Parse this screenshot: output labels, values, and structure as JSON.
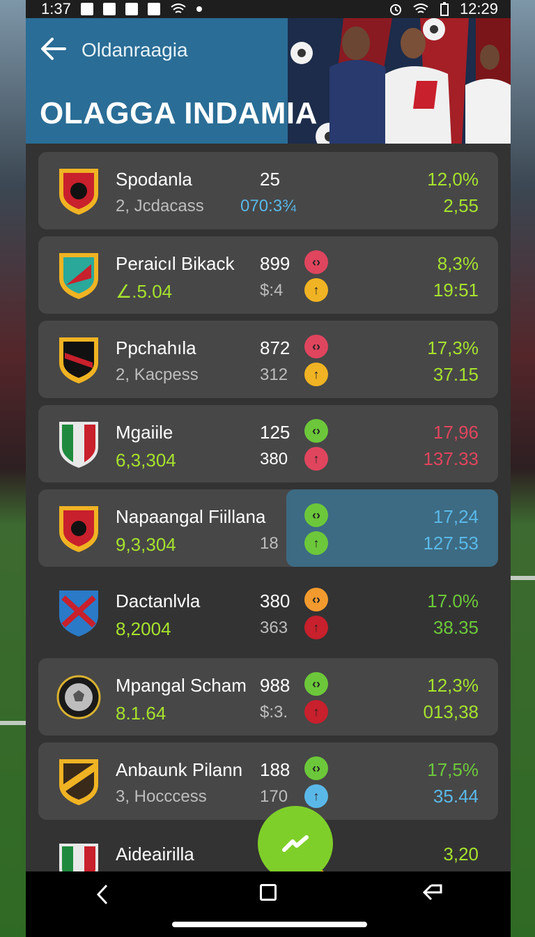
{
  "status_bar": {
    "time_left": "1:37",
    "time_right": "12:29"
  },
  "header": {
    "subtitle": "Oldanraagia",
    "title": "OLAGGA INDAMIA"
  },
  "colors": {
    "green": "#a6e22e",
    "blue": "#5ab8e8",
    "red": "#e0455e",
    "yellow": "#f0b323",
    "orange": "#f29a2e"
  },
  "rows": [
    {
      "team": "Spodanla",
      "sub": "2, Jcdacass",
      "n1": "25",
      "n2": "070:3¾",
      "r1": "12,0%",
      "r2": "2,55",
      "ic_top": "",
      "ic_bot": "",
      "r_color": "green"
    },
    {
      "team": "Peraicıl Bikack",
      "sub": "∠.5.04",
      "n1": "899",
      "n2": "$:4",
      "r1": "8,3%",
      "r2": "19:51",
      "ic_top": "red",
      "ic_bot": "yellow",
      "r_color": "green"
    },
    {
      "team": "Ppchahıla",
      "sub": "2, Kacpess",
      "n1": "872",
      "n2": "312",
      "r1": "17,3%",
      "r2": "37.15",
      "ic_top": "red",
      "ic_bot": "yellow",
      "r_color": "green"
    },
    {
      "team": "Mgaiile",
      "sub": "6,3,304",
      "n1": "125",
      "n2": "380",
      "r1": "17,96",
      "r2": "137.33",
      "ic_top": "green",
      "ic_bot": "red",
      "r_color": "red"
    },
    {
      "team": "Napaangal Fiillana",
      "sub": "9,3,304",
      "n1": "",
      "n2": "18",
      "r1": "17,24",
      "r2": "127.53",
      "ic_top": "green",
      "ic_bot": "green",
      "r_color": "blue"
    },
    {
      "team": "Dactanlvla",
      "sub": "8,2004",
      "n1": "380",
      "n2": "363",
      "r1": "17.0%",
      "r2": "38.35",
      "ic_top": "orange",
      "ic_bot": "red",
      "r_color": "green"
    },
    {
      "team": "Mpangal Scham",
      "sub": "8.1.64",
      "n1": "988",
      "n2": "$:3.",
      "r1": "12,3%",
      "r2": "013,38",
      "ic_top": "green",
      "ic_bot": "red",
      "r_color": "green"
    },
    {
      "team": "Anbaunk Pilann",
      "sub": "3, Hocccess",
      "n1": "188",
      "n2": "170",
      "r1": "17,5%",
      "r2": "35.44",
      "ic_top": "green",
      "ic_bot": "blue",
      "r_color": "green"
    },
    {
      "team": "Aideairilla",
      "sub": "",
      "n1": "",
      "n2": "",
      "r1": "3,20",
      "r2": "",
      "ic_top": "yellow",
      "ic_bot": "yellow",
      "r_color": "green"
    }
  ]
}
